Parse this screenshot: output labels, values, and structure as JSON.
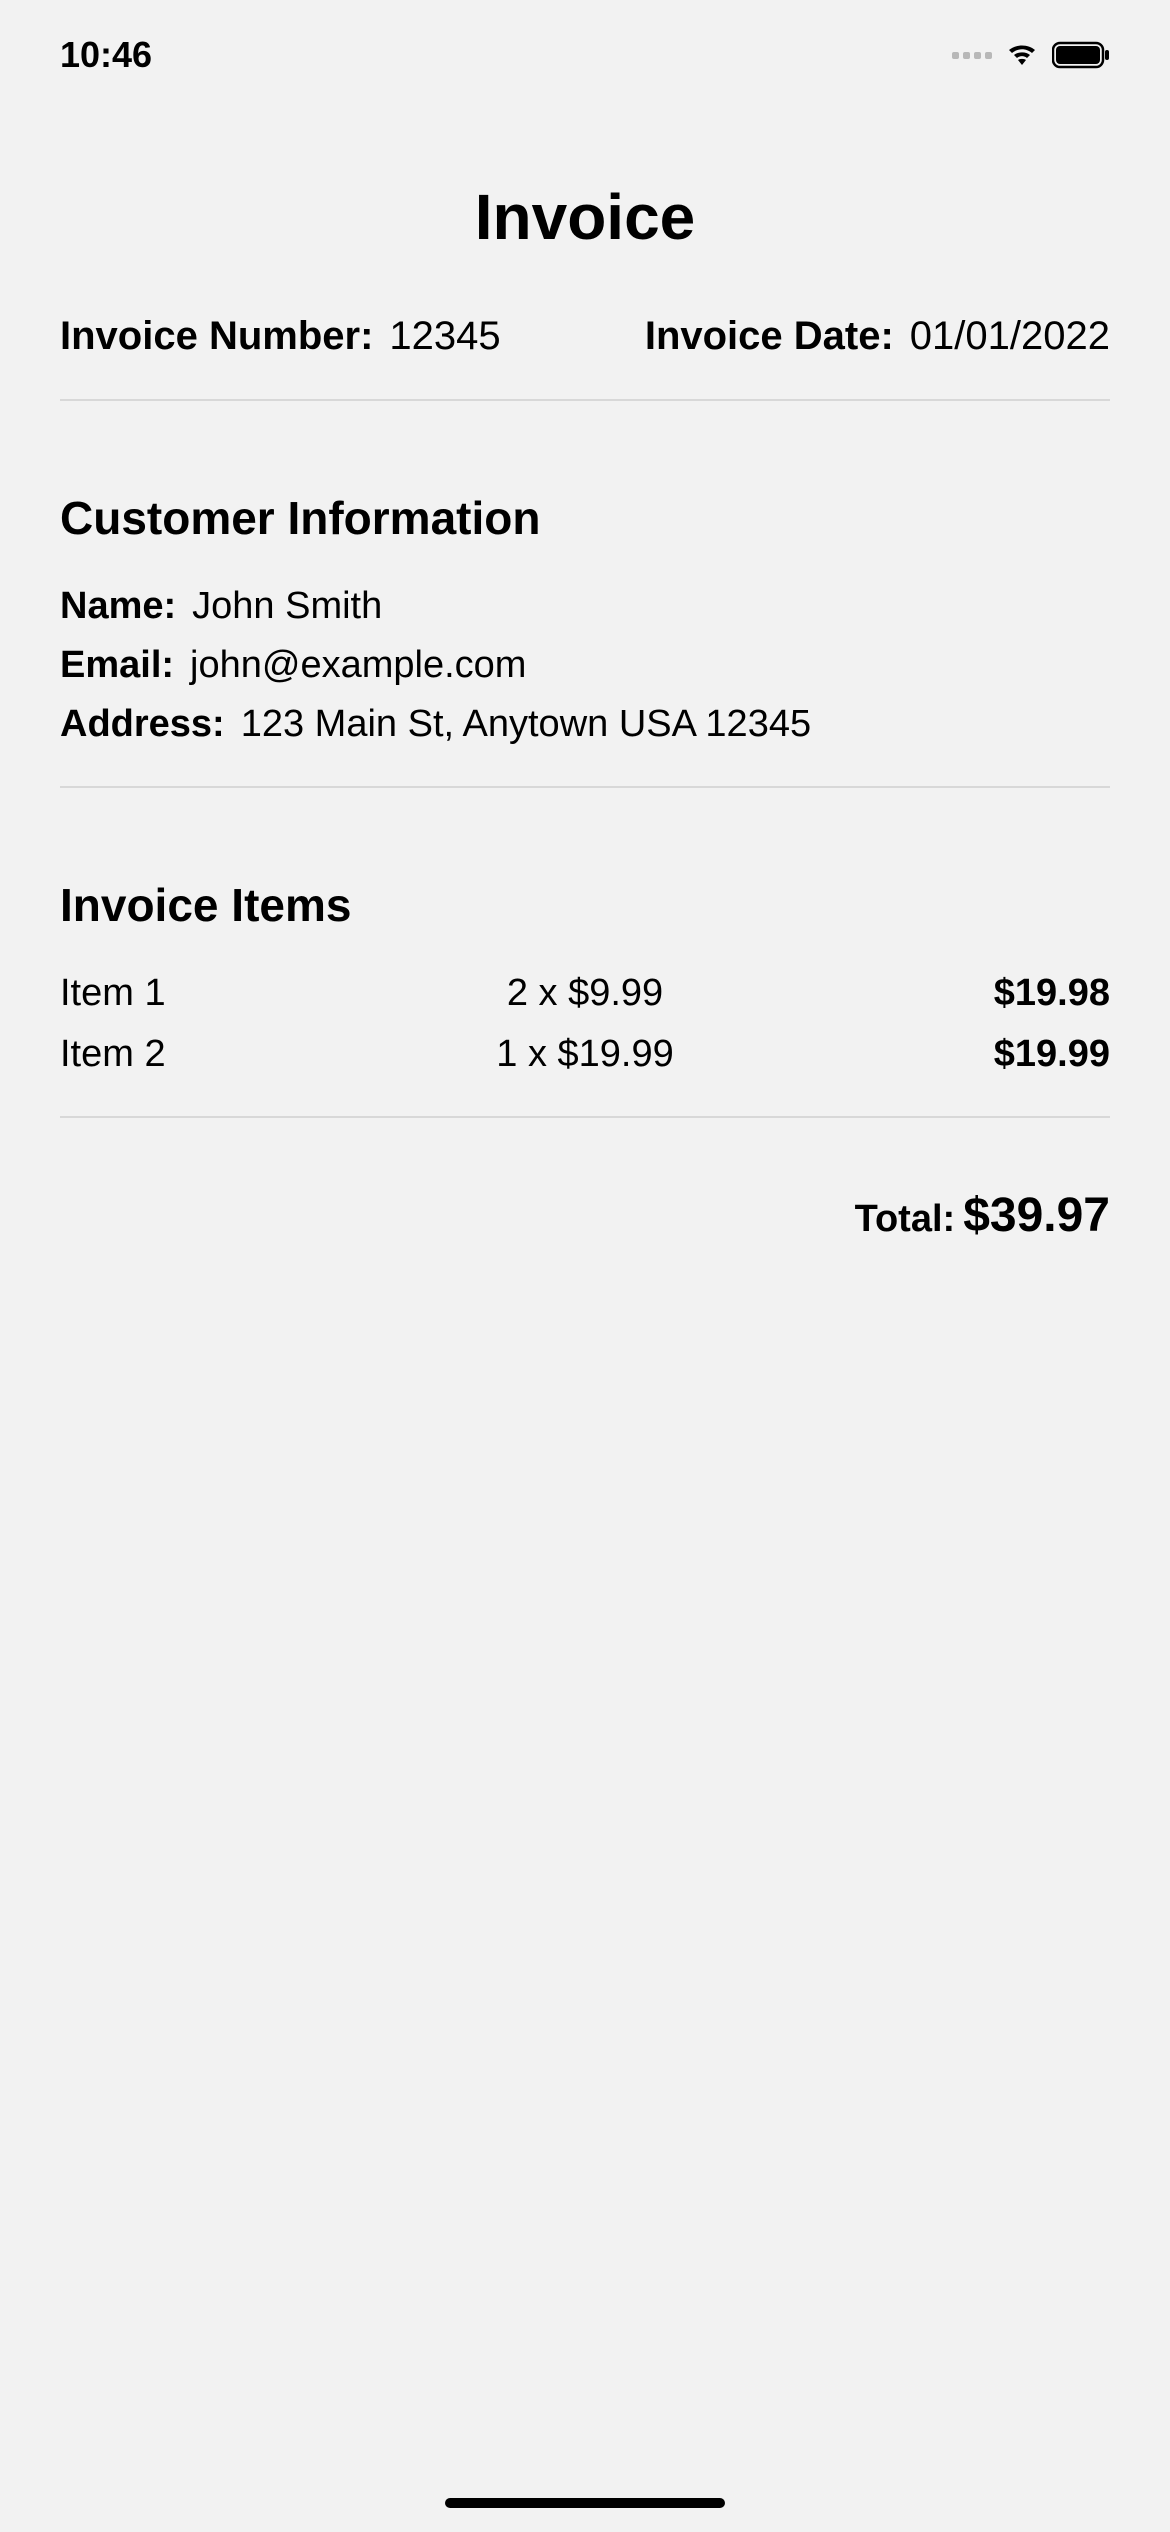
{
  "status_bar": {
    "time": "10:46"
  },
  "invoice": {
    "title": "Invoice",
    "number_label": "Invoice Number:",
    "number_value": "12345",
    "date_label": "Invoice Date:",
    "date_value": "01/01/2022"
  },
  "customer": {
    "section_title": "Customer Information",
    "name_label": "Name:",
    "name_value": "John Smith",
    "email_label": "Email:",
    "email_value": "john@example.com",
    "address_label": "Address:",
    "address_value": "123 Main St, Anytown USA 12345"
  },
  "items": {
    "section_title": "Invoice Items",
    "rows": [
      {
        "name": "Item 1",
        "qty_price": "2 x $9.99",
        "total": "$19.98"
      },
      {
        "name": "Item 2",
        "qty_price": "1 x $19.99",
        "total": "$19.99"
      }
    ]
  },
  "total": {
    "label": "Total:",
    "value": "$39.97"
  }
}
